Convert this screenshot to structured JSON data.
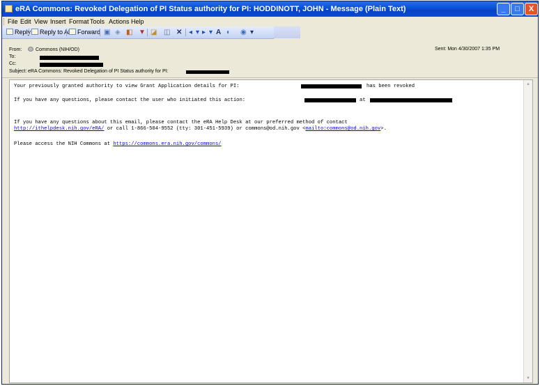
{
  "window": {
    "title": "eRA Commons: Revoked Delegation of PI Status authority for PI: HODDINOTT, JOHN - Message (Plain Text)",
    "controls": [
      "_",
      "□",
      "X"
    ]
  },
  "menu": [
    "File",
    "Edit",
    "View",
    "Insert",
    "Format",
    "Tools",
    "Actions",
    "Help"
  ],
  "toolbar": {
    "reply": "Reply",
    "reply_all": "Reply to All",
    "forward": "Forward"
  },
  "header": {
    "from_label": "From:",
    "from_value": "Commons (NIH/OD)",
    "to_label": "To:",
    "cc_label": "Cc:",
    "subject_label": "Subject:",
    "subject_value": "eRA Commons: Revoked Delegation of PI Status authority for PI:",
    "sent_label": "Sent:",
    "sent_value": "Mon 4/30/2007 1:35 PM"
  },
  "body": {
    "line1_a": "Your previously granted authority to view Grant Application details for PI:",
    "line1_b": "has been revoked",
    "line2_a": "If you have any questions, please contact the user who initiated this action:",
    "line2_b": "at",
    "line3": "If you have any questions about this email, please contact the eRA Help Desk at our preferred method of contact",
    "line4_link1": "http://ithelpdesk.nih.gov/eRA/",
    "line4_mid": " or call 1-866-504-9552 (tty: 301-451-5939) or commons@od.nih.gov <",
    "line4_link2": "mailto:commons@od.nih.gov",
    "line4_end": ">.",
    "line5_a": "Please access the NIH Commons at ",
    "line5_link": "https://commons.era.nih.gov/commons/"
  }
}
